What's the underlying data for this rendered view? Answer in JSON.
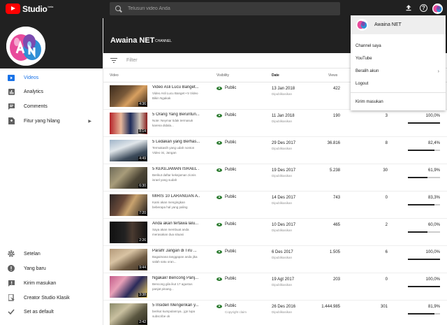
{
  "header": {
    "logo_text": "Studio",
    "logo_beta": "beta",
    "search_placeholder": "Telusuri video Anda"
  },
  "channel": {
    "name": "Awaina NET",
    "tag": "CHANNEL"
  },
  "sidebar": {
    "items": [
      {
        "label": "Videos"
      },
      {
        "label": "Analytics"
      },
      {
        "label": "Comments"
      },
      {
        "label": "Fitur yang hilang"
      }
    ],
    "bottom": [
      {
        "label": "Setelan"
      },
      {
        "label": "Yang baru"
      },
      {
        "label": "Kirim masukan"
      },
      {
        "label": "Creator Studio Klasik"
      },
      {
        "label": "Set as default"
      }
    ]
  },
  "filter": {
    "placeholder": "Filter"
  },
  "table": {
    "headers": {
      "video": "Video",
      "visibility": "Visibility",
      "date": "Date",
      "views": "Views"
    },
    "rows": [
      {
        "title": "Video Asli Lucu Banget...",
        "desc": "Video Asli Lucu Banget • 5 Video Bikin Ngakak",
        "duration": "4:36",
        "visibility": "Public",
        "vis_sub": "",
        "date": "13 Jan 2018",
        "date_sub": "Dipublikasikan",
        "views": "422",
        "comments": "",
        "likes": "",
        "like_pct": 1.0
      },
      {
        "title": "5 Orang Yang Beruntun...",
        "desc": "Note: Neymar tidak termasuk karena didala...",
        "duration": "8:14",
        "visibility": "Public",
        "vis_sub": "",
        "date": "11 Jan 2018",
        "date_sub": "Dipublikasikan",
        "views": "190",
        "comments": "3",
        "likes": "100,0%",
        "like_pct": 1.0
      },
      {
        "title": "5 Ledakan yang Berhas...",
        "desc": "Termakasih yang udah nonton Video ini, Jangan",
        "duration": "4:49",
        "visibility": "Public",
        "vis_sub": "",
        "date": "29 Des 2017",
        "date_sub": "Dipublikasikan",
        "views": "36.816",
        "comments": "8",
        "likes": "82,4%",
        "like_pct": 0.824
      },
      {
        "title": "5 KEKEJAMAN ISRAEL ...",
        "desc": "Berikut daftar kekejaman zionis israel yang sudah",
        "duration": "6:30",
        "visibility": "Public",
        "vis_sub": "",
        "date": "19 Des 2017",
        "date_sub": "Dipublikasikan",
        "views": "5.238",
        "comments": "30",
        "likes": "61,9%",
        "like_pct": 0.619
      },
      {
        "title": "MIRIS 10 LARANGAN A...",
        "desc": "Kami akan mengingkan beberapa hal yang paling",
        "duration": "7:20",
        "visibility": "Public",
        "vis_sub": "",
        "date": "14 Des 2017",
        "date_sub": "Dipublikasikan",
        "views": "743",
        "comments": "0",
        "likes": "83,3%",
        "like_pct": 0.833
      },
      {
        "title": "Anda akan tertawa lalu...",
        "desc": "Saya akan membuat anda merasakan dua situasi",
        "duration": "2:26",
        "visibility": "Public",
        "vis_sub": "",
        "date": "10 Des 2017",
        "date_sub": "Dipublikasikan",
        "views": "465",
        "comments": "2",
        "likes": "60,0%",
        "like_pct": 0.6
      },
      {
        "title": "Parah! Jangan di Tiru ...",
        "desc": "Bagaimana tanggapan anda jika salah satu oran...",
        "duration": "9:44",
        "visibility": "Public",
        "vis_sub": "",
        "date": "6 Des 2017",
        "date_sub": "Dipublikasikan",
        "views": "1.505",
        "comments": "6",
        "likes": "100,0%",
        "like_pct": 1.0
      },
      {
        "title": "Ngakak! Bencong Panj...",
        "desc": "Bencong gila ikut 17 agustus panjat pinang...",
        "duration": "3:38",
        "visibility": "Public",
        "vis_sub": "",
        "date": "19 Agt 2017",
        "date_sub": "Dipublikasikan",
        "views": "203",
        "comments": "0",
        "likes": "100,0%",
        "like_pct": 1.0
      },
      {
        "title": "5 Insiden Mengerikan y...",
        "desc": "berikut kumpulannya.. jgn lupa subscribe ok",
        "duration": "2:42",
        "visibility": "Public",
        "vis_sub": "Copyright claim",
        "date": "26 Des 2016",
        "date_sub": "Dipublikasikan",
        "views": "1.444.985",
        "comments": "301",
        "likes": "81,9%",
        "like_pct": 0.819
      }
    ]
  },
  "account_menu": {
    "name": "Awaina NET",
    "items": [
      "Channel saya",
      "YouTube",
      "Beralih akun",
      "Logout",
      "Kirim masukan"
    ]
  },
  "colors": {
    "header_bg": "#212121",
    "accent": "#1a73e8",
    "public_icon": "#2e7d32",
    "youtube_red": "#ff0000"
  }
}
